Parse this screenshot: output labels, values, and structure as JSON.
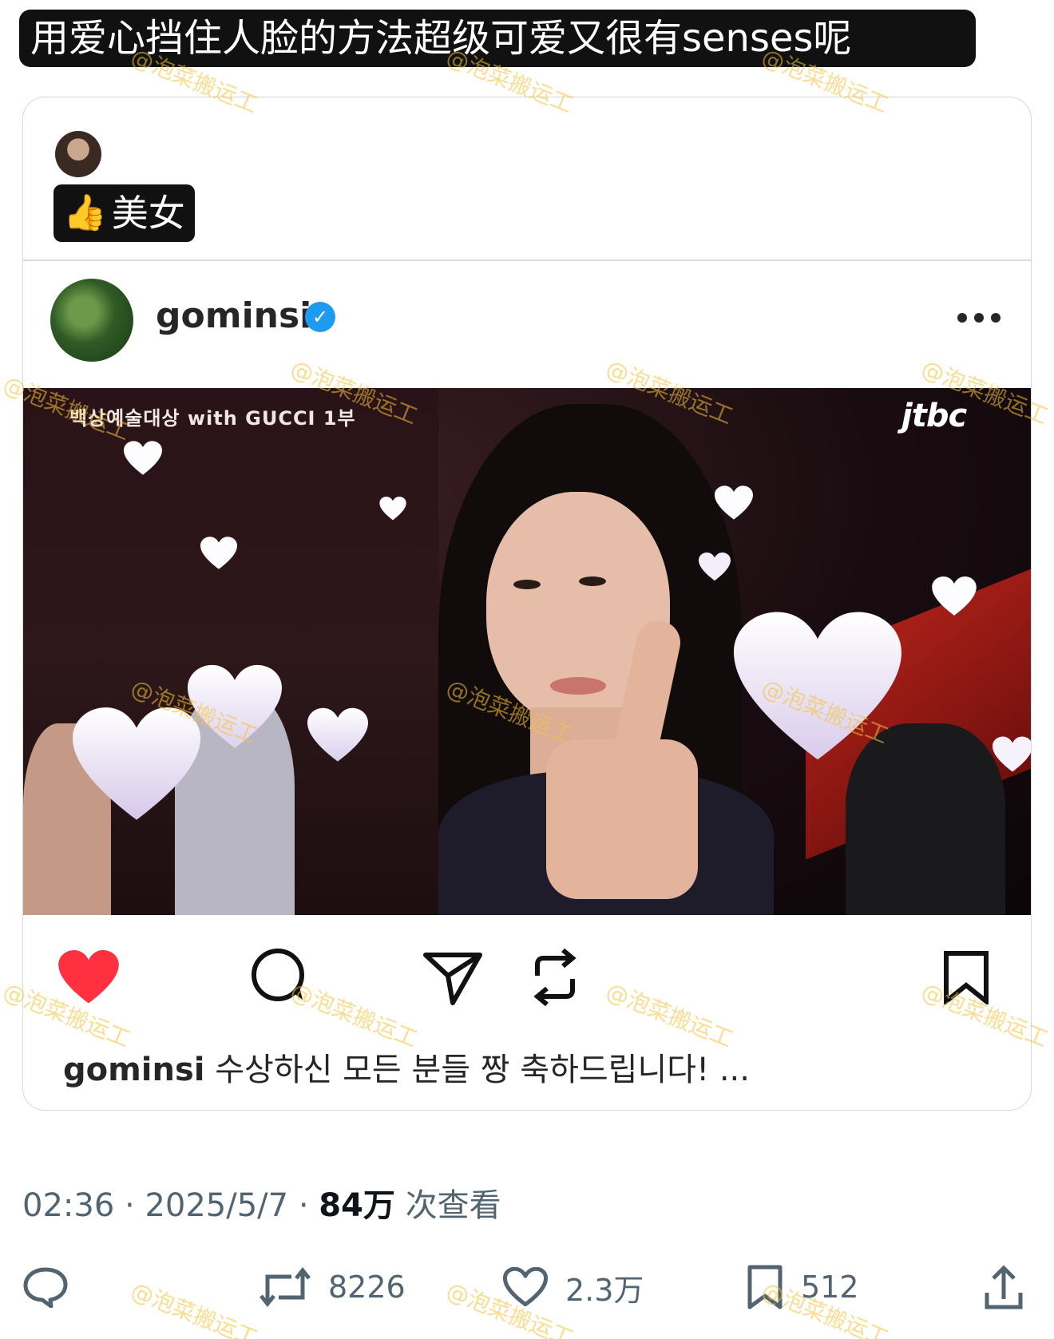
{
  "caption_banner": {
    "text": "用爱心挡住人脸的方法超级可爱又很有senses呢"
  },
  "quote_card": {
    "text": "美女",
    "thumb": "👍",
    "ig_post": {
      "username": "gominsi",
      "verified": true,
      "broadcast_tag": "백상예술대상 with GUCCI 1부",
      "channel_logo": "jtbc",
      "caption_user": "gominsi",
      "caption_text": "수상하신 모든 분들 짱 축하드립니다! ..."
    }
  },
  "meta": {
    "time": "02:36",
    "date": "2025/5/7",
    "views": "84万",
    "views_label": "次查看"
  },
  "stats": {
    "retweets": "8226",
    "likes": "2.3万",
    "bookmarks": "512"
  },
  "watermark_text": "@泡菜搬运工",
  "colors": {
    "like_red": "#ff3040",
    "verified_blue": "#1d9bf0",
    "watermark": "#f5c23b"
  }
}
